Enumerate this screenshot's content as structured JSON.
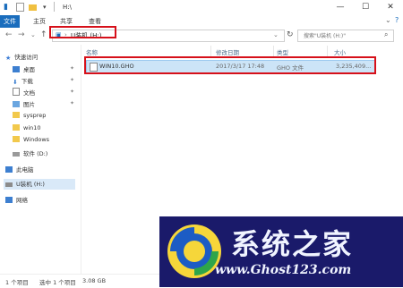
{
  "window": {
    "title": "H:\\",
    "minimize": "—",
    "maximize": "☐",
    "close": "✕"
  },
  "ribbon": {
    "tabs": [
      "文件",
      "主页",
      "共享",
      "查看"
    ]
  },
  "address": {
    "crumb": "U装机 (H:)",
    "chevron": "›",
    "search_placeholder": "搜索\"U装机 (H:)\""
  },
  "sidebar": {
    "items": [
      {
        "label": "快速访问",
        "icon": "star-icon",
        "pinned": false
      },
      {
        "label": "桌面",
        "icon": "desktop-icon",
        "pinned": true
      },
      {
        "label": "下载",
        "icon": "download-icon",
        "pinned": true
      },
      {
        "label": "文档",
        "icon": "document-icon",
        "pinned": true
      },
      {
        "label": "图片",
        "icon": "picture-icon",
        "pinned": true
      },
      {
        "label": "sysprep",
        "icon": "folder-icon",
        "pinned": false
      },
      {
        "label": "win10",
        "icon": "folder-icon",
        "pinned": false
      },
      {
        "label": "Windows",
        "icon": "folder-icon",
        "pinned": false
      },
      {
        "label": "软件 (D:)",
        "icon": "drive-icon",
        "pinned": false
      },
      {
        "label": "此电脑",
        "icon": "computer-icon",
        "pinned": false
      },
      {
        "label": "U装机 (H:)",
        "icon": "usb-drive-icon",
        "pinned": false
      },
      {
        "label": "网络",
        "icon": "network-icon",
        "pinned": false
      }
    ]
  },
  "columns": {
    "name": "名称",
    "date": "修改日期",
    "type": "类型",
    "size": "大小"
  },
  "files": [
    {
      "name": "WIN10.GHO",
      "date": "2017/3/17 17:48",
      "type": "GHO 文件",
      "size": "3,235,409..."
    }
  ],
  "status": {
    "count": "1 个项目",
    "selected": "选中 1 个项目",
    "size": "3.08 GB"
  },
  "watermark": {
    "title": "系统之家",
    "url": "www.Ghost123.com"
  },
  "colors": {
    "highlight_border": "#d6101a",
    "selection": "#cce4f7",
    "file_tab": "#1a6dbd"
  }
}
